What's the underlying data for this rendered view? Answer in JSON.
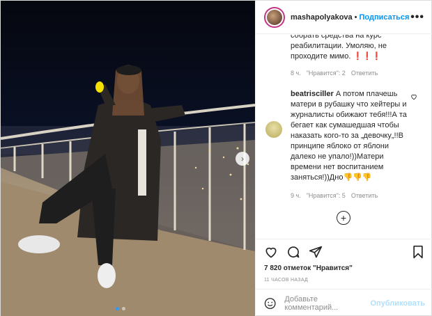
{
  "header": {
    "username": "mashapolyakova",
    "separator": "•",
    "follow_label": "Подписаться",
    "more_label": "•••"
  },
  "comments": [
    {
      "text": "собрать средства на курс реабилитации. Умоляю, не проходите мимо. ❗❗❗",
      "time": "8 ч.",
      "likes": "\"Нравится\": 2",
      "reply": "Ответить"
    },
    {
      "author": "beatrisciller",
      "text": " А потом плачешь матери в рубашку что хейтеры и журналисты обижают тебя!!!А та бегает как сумашедшая чтобы наказать кого-то за „девочку„!!В принципе яблоко от яблони далеко не упало!))Матери времени нет воспитанием заняться!))Дно👎👎👎",
      "time": "9 ч.",
      "likes": "\"Нравится\": 5",
      "reply": "Ответить"
    }
  ],
  "load_more": "+",
  "likes_count": "7 820 отметок \"Нравится\"",
  "timestamp": "11 ЧАСОВ НАЗАД",
  "add_comment": {
    "placeholder": "Добавьте комментарий...",
    "publish_label": "Опубликовать"
  },
  "carousel": {
    "total": 2,
    "active": 1,
    "next": "›"
  },
  "colors": {
    "link": "#0095f6",
    "publish_disabled": "#b2dffc",
    "secondary": "#8e8e8e"
  },
  "icons": [
    "heart-icon",
    "comment-icon",
    "share-icon",
    "bookmark-icon",
    "smile-icon",
    "more-icon",
    "plus-circle-icon"
  ]
}
